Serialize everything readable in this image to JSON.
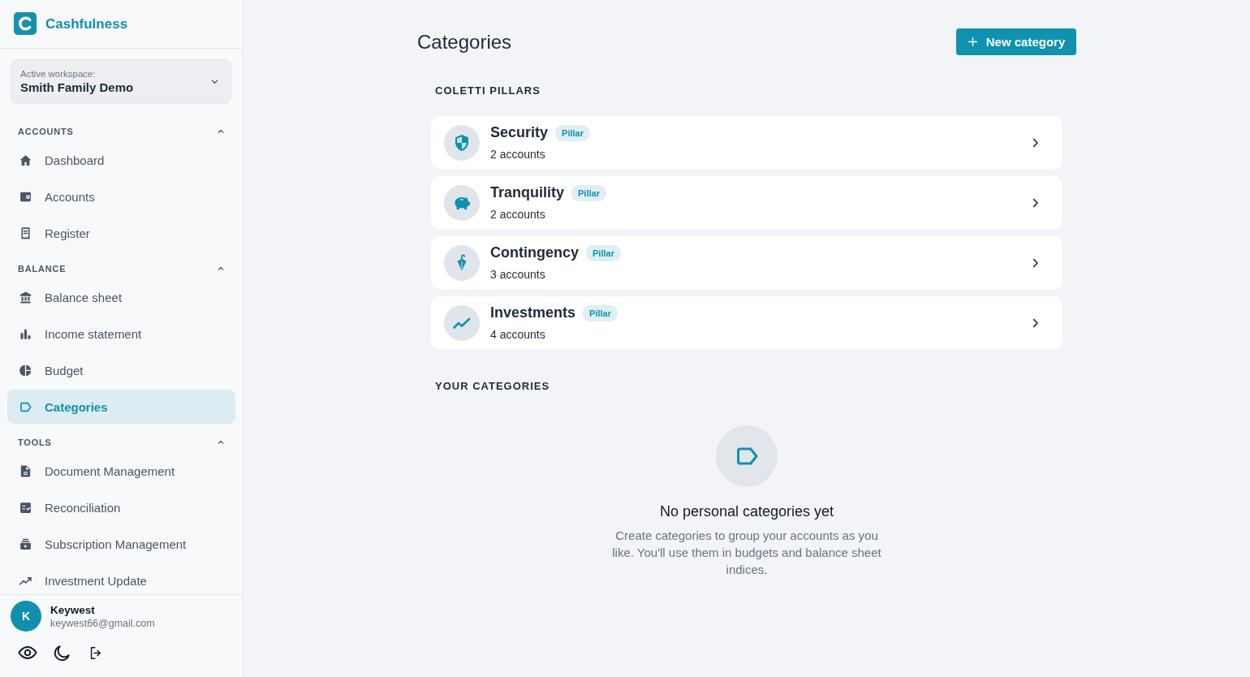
{
  "app": {
    "name": "Cashfulness"
  },
  "workspace": {
    "label": "Active workspace:",
    "name": "Smith Family Demo"
  },
  "sidebar": {
    "sections": [
      {
        "title": "ACCOUNTS",
        "expanded": true,
        "items": [
          {
            "label": "Dashboard",
            "selected": false
          },
          {
            "label": "Accounts",
            "selected": false
          },
          {
            "label": "Register",
            "selected": false
          }
        ]
      },
      {
        "title": "BALANCE",
        "expanded": true,
        "items": [
          {
            "label": "Balance sheet",
            "selected": false
          },
          {
            "label": "Income statement",
            "selected": false
          },
          {
            "label": "Budget",
            "selected": false
          },
          {
            "label": "Categories",
            "selected": true
          }
        ]
      },
      {
        "title": "TOOLS",
        "expanded": true,
        "items": [
          {
            "label": "Document Management",
            "selected": false
          },
          {
            "label": "Reconciliation",
            "selected": false
          },
          {
            "label": "Subscription Management",
            "selected": false
          },
          {
            "label": "Investment Update",
            "selected": false
          }
        ]
      }
    ]
  },
  "user": {
    "initial": "K",
    "name": "Keywest",
    "email": "keywest66@gmail.com"
  },
  "page": {
    "title": "Categories",
    "new_button": "New category"
  },
  "pillars": {
    "title": "COLETTI PILLARS",
    "items": [
      {
        "name": "Security",
        "badge": "Pillar",
        "count": "2 accounts"
      },
      {
        "name": "Tranquility",
        "badge": "Pillar",
        "count": "2 accounts"
      },
      {
        "name": "Contingency",
        "badge": "Pillar",
        "count": "3 accounts"
      },
      {
        "name": "Investments",
        "badge": "Pillar",
        "count": "4 accounts"
      }
    ]
  },
  "your_categories": {
    "title": "YOUR CATEGORIES",
    "empty_title": "No personal categories yet",
    "empty_text": "Create categories to group your accounts as you like. You'll use them in budgets and balance sheet indices."
  }
}
